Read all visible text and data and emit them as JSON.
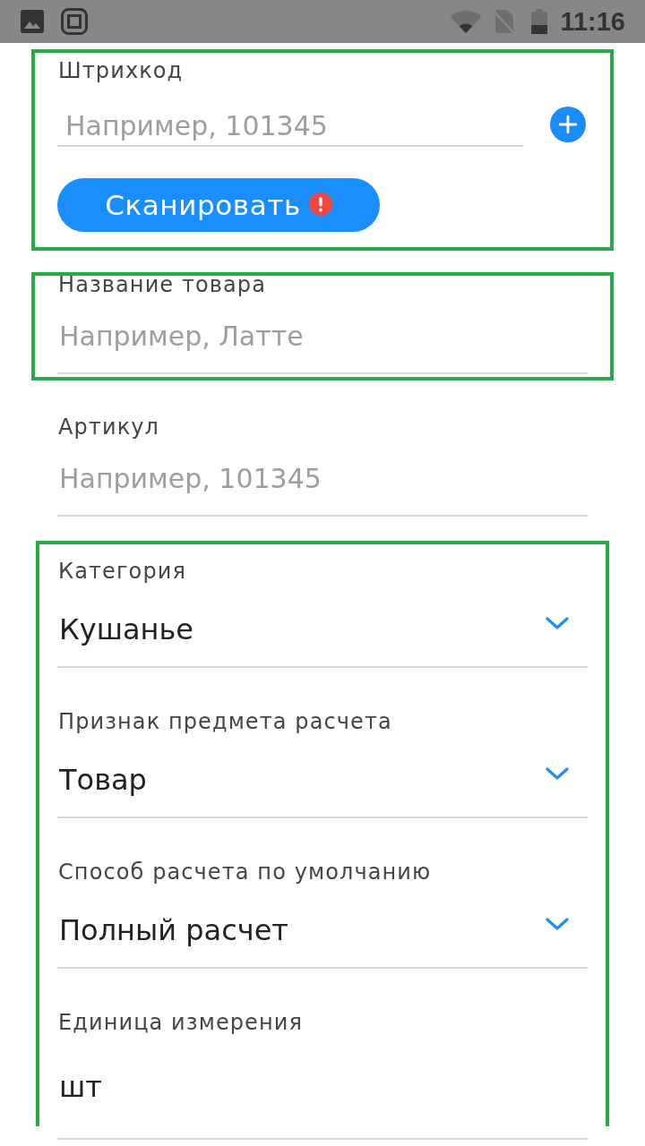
{
  "status_bar": {
    "time": "11:16"
  },
  "sections": [
    {
      "highlighted": true,
      "fields": [
        {
          "kind": "barcode",
          "label": "Штрихкод",
          "placeholder": "Например, 101345",
          "button": {
            "label": "Сканировать",
            "alert": true
          }
        }
      ]
    },
    {
      "highlighted": true,
      "fields": [
        {
          "kind": "text",
          "label": "Название товара",
          "placeholder": "Например, Латте"
        }
      ]
    },
    {
      "highlighted": false,
      "fields": [
        {
          "kind": "text",
          "label": "Артикул",
          "placeholder": "Например, 101345"
        }
      ]
    },
    {
      "highlighted": true,
      "fields": [
        {
          "kind": "select",
          "label": "Категория",
          "value": "Кушанье"
        },
        {
          "kind": "select",
          "label": "Признак предмета расчета",
          "value": "Товар"
        },
        {
          "kind": "select",
          "label": "Способ расчета по умолчанию",
          "value": "Полный расчет"
        },
        {
          "kind": "text",
          "label": "Единица измерения",
          "value": "шт"
        }
      ]
    }
  ]
}
